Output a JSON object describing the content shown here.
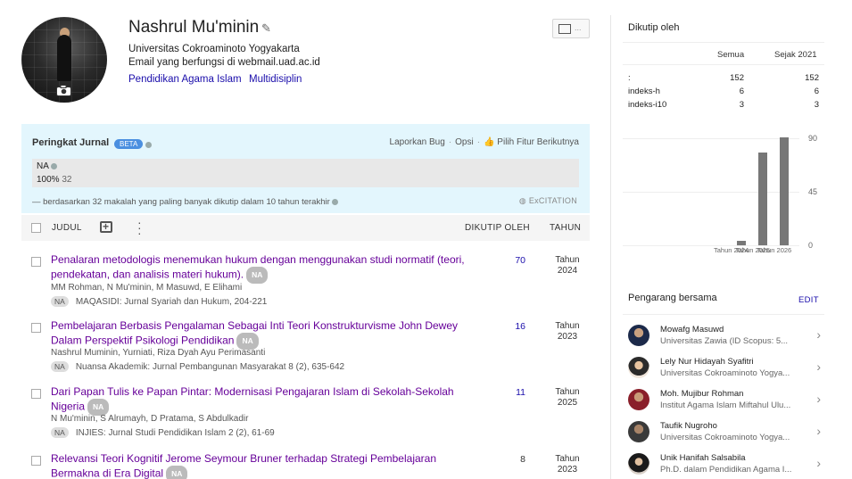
{
  "profile": {
    "name": "Nashrul Mu'minin",
    "affiliation": "Universitas Cokroaminoto Yogyakarta",
    "email": "Email yang berfungsi di webmail.uad.ac.id",
    "interests": [
      "Pendidikan Agama Islam",
      "Multidisiplin"
    ],
    "follow_dots": "..."
  },
  "journal_rank": {
    "title": "Peringkat Jurnal",
    "beta": "BETA",
    "links": [
      "Laporkan Bug",
      "Opsi",
      "Pilih Fitur Berikutnya"
    ],
    "na": "NA",
    "percent": "100%",
    "count": "32",
    "note": "— berdasarkan 32 makalah yang paling banyak dikutip dalam 10 tahun terakhir",
    "brand": "ExCITATION"
  },
  "table": {
    "col_title": "JUDUL",
    "col_cited": "DIKUTIP OLEH",
    "col_year": "TAHUN",
    "na_label": "NA",
    "articles": [
      {
        "title": "Penalaran metodologis menemukan hukum dengan menggunakan studi normatif (teori, pendekatan, dan analisis materi hukum).",
        "authors": "MM Rohman, N Mu'minin, M Masuwd, E Elihami",
        "venue": "MAQASIDI: Jurnal Syariah dan Hukum, 204-221",
        "cited": "70",
        "year_label": "Tahun",
        "year": "2024"
      },
      {
        "title": "Pembelajaran Berbasis Pengalaman Sebagai Inti Teori Konstrukturvisme John Dewey Dalam Perspektif Psikologi Pendidikan",
        "authors": "Nashrul Muminin, Yurniati, Riza Dyah Ayu Perimasanti",
        "venue": "Nuansa Akademik: Jurnal Pembangunan Masyarakat 8 (2), 635-642",
        "cited": "16",
        "year_label": "Tahun",
        "year": "2023"
      },
      {
        "title": "Dari Papan Tulis ke Papan Pintar: Modernisasi Pengajaran Islam di Sekolah-Sekolah Nigeria",
        "authors": "N Mu'minin, S Alrumayh, D Pratama, S Abdulkadir",
        "venue": "INJIES: Jurnal Studi Pendidikan Islam 2 (2), 61-69",
        "cited": "11",
        "year_label": "Tahun",
        "year": "2025"
      },
      {
        "title": "Relevansi Teori Kognitif Jerome Seymour Bruner terhadap Strategi Pembelajaran Bermakna di Era Digital",
        "authors": "",
        "venue": "",
        "cited": "8",
        "year_label": "Tahun",
        "year": "2023"
      }
    ]
  },
  "cited_by": {
    "title": "Dikutip oleh",
    "col_all": "Semua",
    "col_since": "Sejak 2021",
    "rows": [
      {
        "label": ":",
        "all": "152",
        "since": "152"
      },
      {
        "label": "indeks-h",
        "all": "6",
        "since": "6"
      },
      {
        "label": "indeks-i10",
        "all": "3",
        "since": "3"
      }
    ]
  },
  "chart_data": {
    "type": "bar",
    "categories": [
      "Tahun 2024",
      "Tahun 2025",
      "Tahun 2026"
    ],
    "values": [
      4,
      78,
      91
    ],
    "yticks": [
      "90",
      "45",
      "0"
    ],
    "ylim": [
      0,
      90
    ]
  },
  "coauthors": {
    "title": "Pengarang bersama",
    "edit": "EDIT",
    "items": [
      {
        "name": "Mowafg Masuwd",
        "affil": "Universitas Zawia (ID Scopus: 5..."
      },
      {
        "name": "Lely Nur Hidayah Syafitri",
        "affil": "Universitas Cokroaminoto Yogya..."
      },
      {
        "name": "Moh. Mujibur Rohman",
        "affil": "Institut Agama Islam Miftahul Ulu..."
      },
      {
        "name": "Taufik Nugroho",
        "affil": "Universitas Cokroaminoto Yogya..."
      },
      {
        "name": "Unik Hanifah Salsabila",
        "affil": "Ph.D. dalam Pendidikan Agama I..."
      }
    ]
  },
  "colors": {
    "link": "#1a0dab",
    "visited": "#660099",
    "panel": "#e3f6fd",
    "bar": "#777777"
  }
}
